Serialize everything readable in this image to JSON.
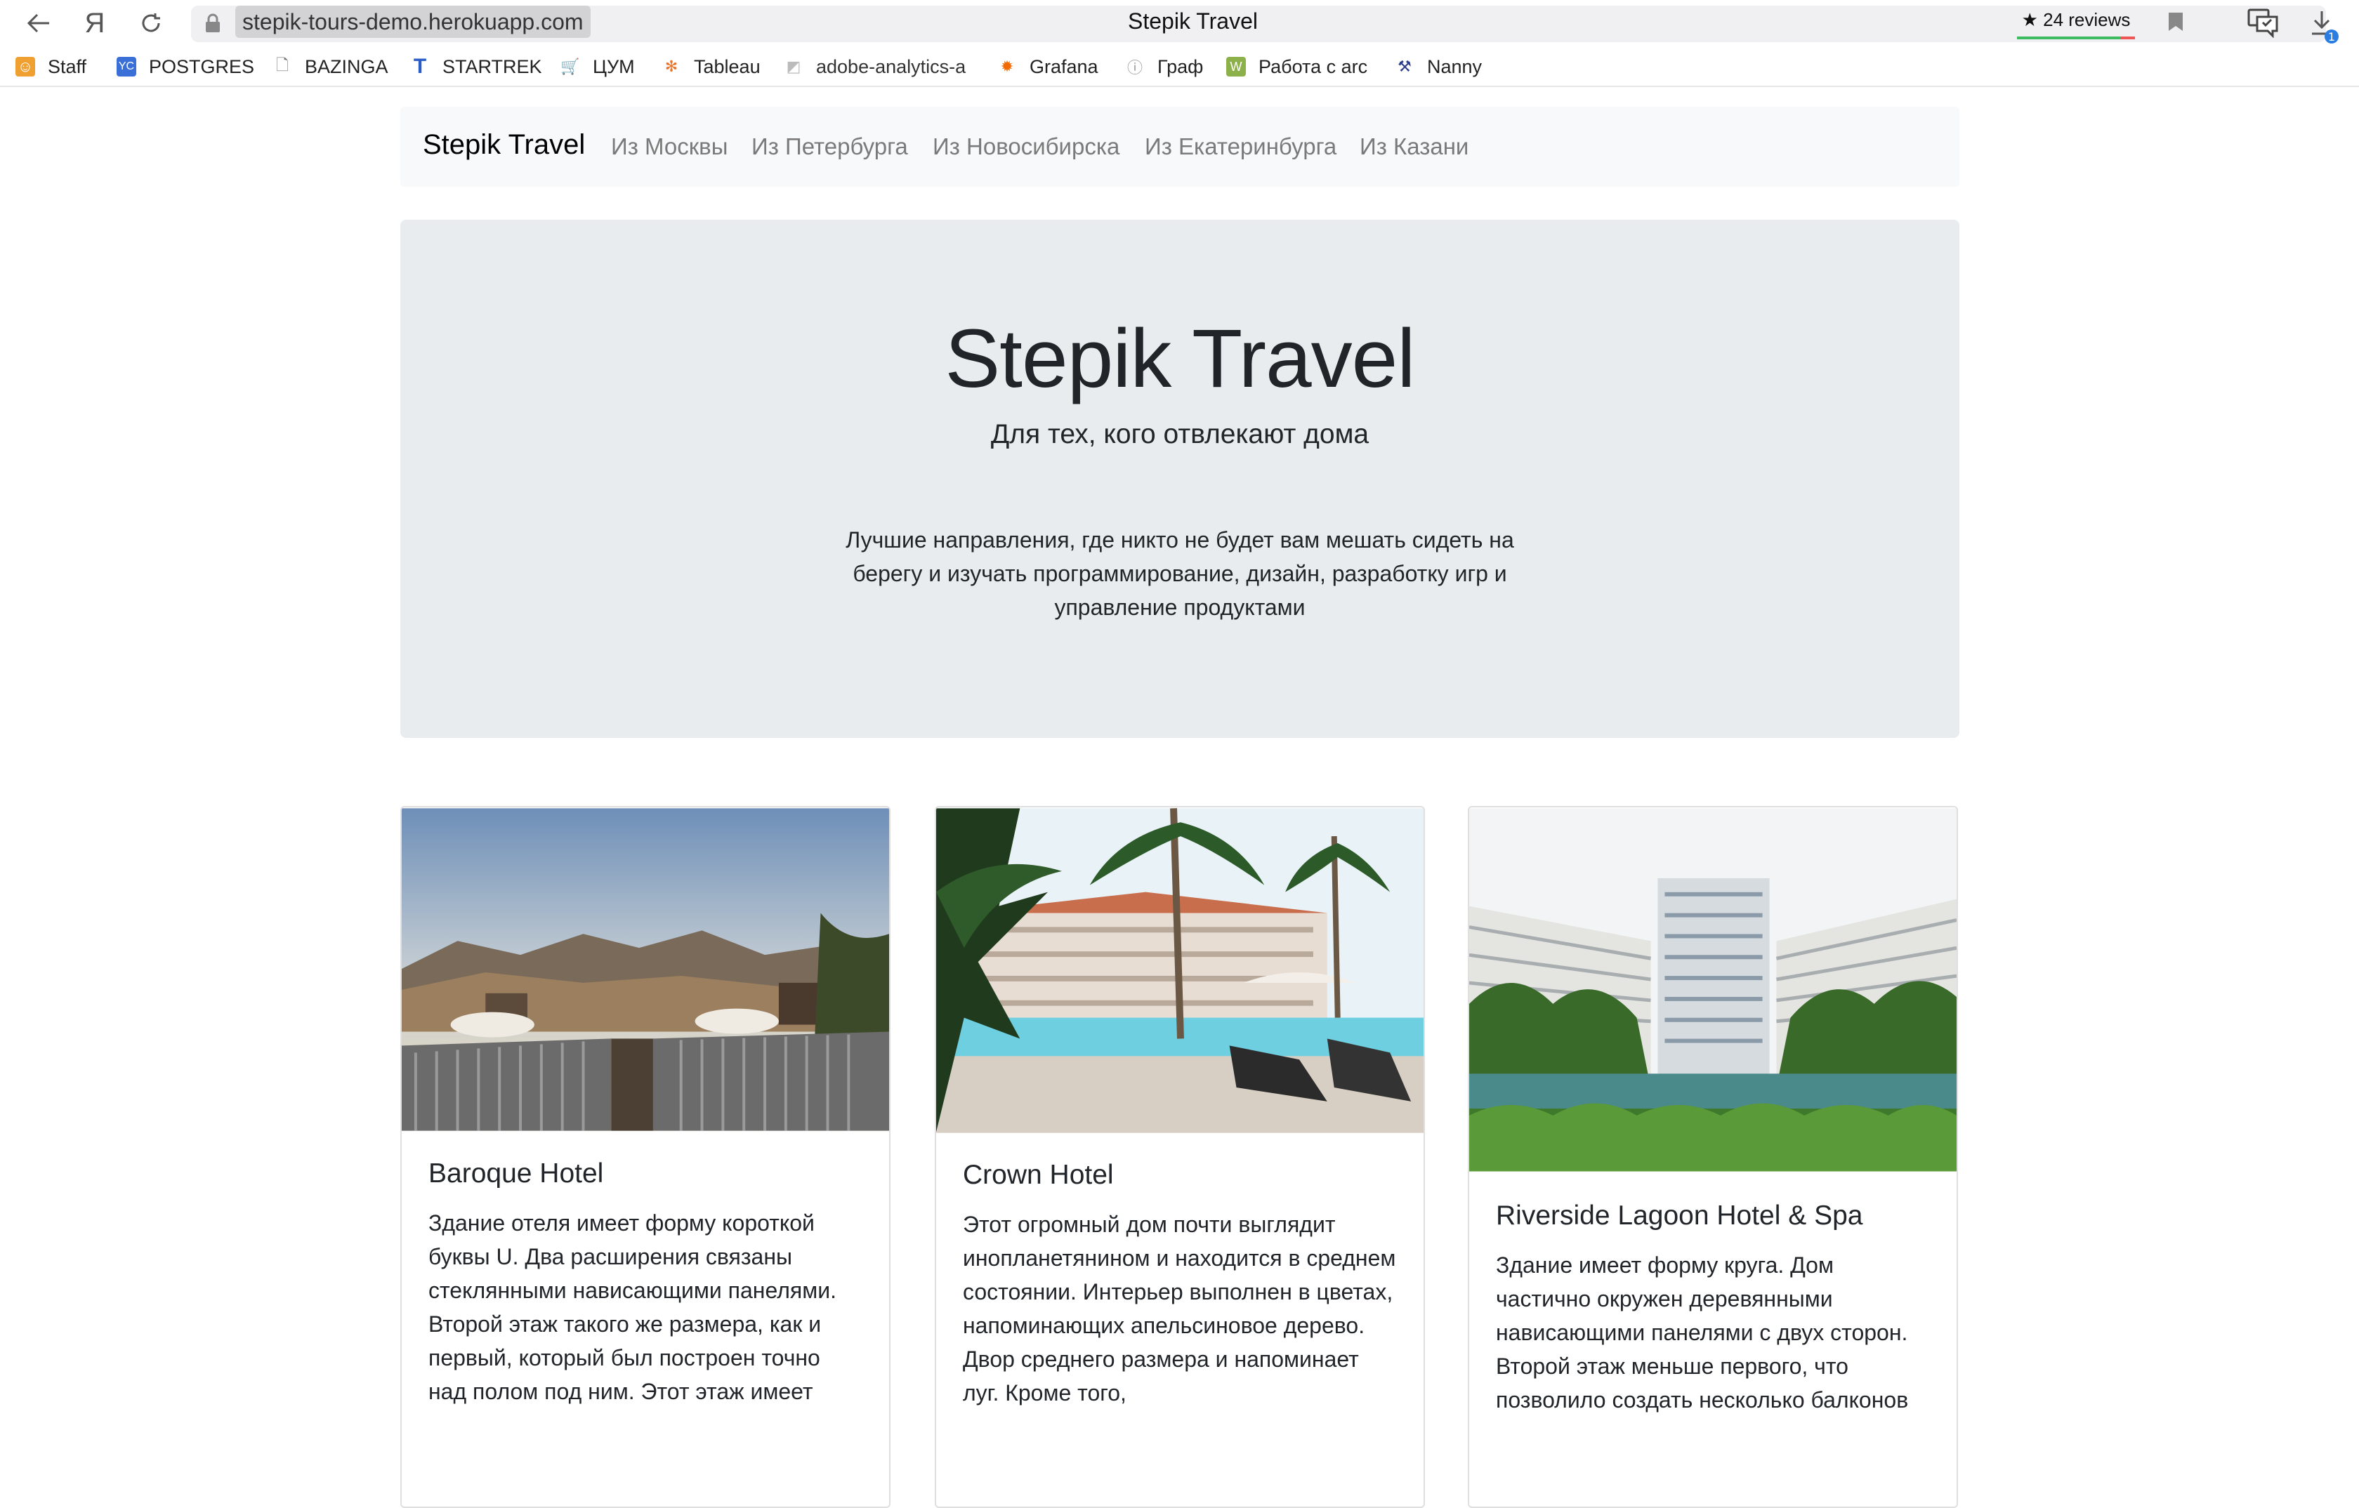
{
  "browser": {
    "url": "stepik-tours-demo.herokuapp.com",
    "tab_title": "Stepik Travel",
    "reviews": "★ 24 reviews",
    "downloads_count": "1",
    "bookmarks": [
      {
        "label": "Staff",
        "icon": "staff-icon",
        "color": "#f0a030"
      },
      {
        "label": "POSTGRES",
        "icon": "yc-icon",
        "color": "#3b6fd8"
      },
      {
        "label": "BAZINGA",
        "icon": "page-icon",
        "color": "#888888"
      },
      {
        "label": "STARTREK",
        "icon": "startrek-icon",
        "color": "#2a5cc8"
      },
      {
        "label": "ЦУМ",
        "icon": "cart-icon",
        "color": "#2a3b8c"
      },
      {
        "label": "Tableau",
        "icon": "tableau-icon",
        "color": "#e8762c"
      },
      {
        "label": "adobe-analytics-a",
        "icon": "adobe-icon",
        "color": "#bbbbbb"
      },
      {
        "label": "Grafana",
        "icon": "grafana-icon",
        "color": "#f46800"
      },
      {
        "label": "Граф",
        "icon": "info-icon",
        "color": "#999999"
      },
      {
        "label": "Работа с arc",
        "icon": "w-icon",
        "color": "#8cb04a"
      },
      {
        "label": "Nanny",
        "icon": "nanny-icon",
        "color": "#2a3b8c"
      }
    ]
  },
  "navbar": {
    "brand": "Stepik Travel",
    "links": [
      "Из Москвы",
      "Из Петербурга",
      "Из Новосибирска",
      "Из Екатеринбурга",
      "Из Казани"
    ]
  },
  "hero": {
    "title": "Stepik Travel",
    "subtitle": "Для тех, кого отвлекают дома",
    "lead": "Лучшие направления, где никто не будет вам мешать сидеть на берегу и изучать программирование, дизайн, разработку игр и управление продуктами"
  },
  "cards": [
    {
      "title": "Baroque Hotel",
      "text": "Здание отеля имеет форму короткой буквы U. Два расширения связаны стеклянными нависающими панелями. Второй этаж такого же размера, как и первый, который был построен точно над полом под ним. Этот этаж имеет"
    },
    {
      "title": "Crown Hotel",
      "text": "Этот огромный дом почти выглядит инопланетянином и находится в среднем состоянии. Интерьер выполнен в цветах, напоминающих апельсиновое дерево. Двор среднего размера и напоминает луг. Кроме того,"
    },
    {
      "title": "Riverside Lagoon Hotel & Spa",
      "text": "Здание имеет форму круга. Дом частично окружен деревянными нависающими панелями с двух сторон. Второй этаж меньше первого, что позволило создать несколько балконов"
    }
  ]
}
